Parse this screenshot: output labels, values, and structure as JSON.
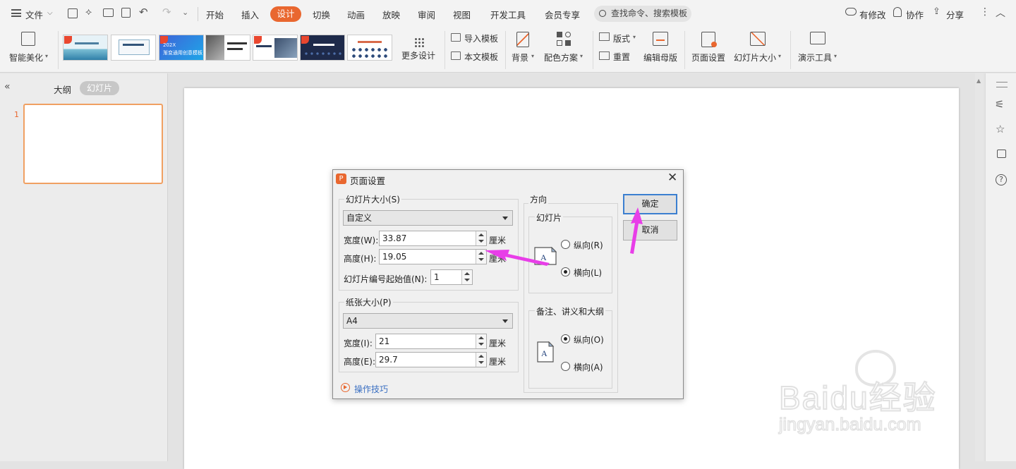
{
  "menubar": {
    "file": "文件",
    "tabs": [
      "开始",
      "插入",
      "设计",
      "切换",
      "动画",
      "放映",
      "审阅",
      "视图",
      "开发工具",
      "会员专享"
    ],
    "active_tab": "设计",
    "search_placeholder": "查找命令、搜索模板",
    "modified": "有修改",
    "collab": "协作",
    "share": "分享"
  },
  "ribbon": {
    "smart_beautify": "智能美化",
    "more_design": "更多设计",
    "import_template": "导入模板",
    "this_template": "本文模板",
    "background": "背景",
    "color_scheme": "配色方案",
    "layout": "版式",
    "reset": "重置",
    "edit_master": "编辑母版",
    "page_setup": "页面设置",
    "slide_size": "幻灯片大小",
    "present_tools": "演示工具",
    "thumb2_line1": "202X",
    "thumb2_line2": "渐变通用创意模板"
  },
  "left_panel": {
    "outline_tab": "大纲",
    "slides_tab": "幻灯片",
    "slide_number": "1"
  },
  "dialog": {
    "title": "页面设置",
    "slide_size_group": "幻灯片大小(S)",
    "slide_size_value": "自定义",
    "width_label": "宽度(W):",
    "width_value": "33.87",
    "height_label": "高度(H):",
    "height_value": "19.05",
    "unit": "厘米",
    "start_num_label": "幻灯片编号起始值(N):",
    "start_num_value": "1",
    "paper_group": "纸张大小(P)",
    "paper_value": "A4",
    "paper_width_label": "宽度(I):",
    "paper_width_value": "21",
    "paper_height_label": "高度(E):",
    "paper_height_value": "29.7",
    "tips": "操作技巧",
    "orientation": "方向",
    "slide_orient_group": "幻灯片",
    "portrait_r": "纵向(R)",
    "landscape_l": "横向(L)",
    "notes_group": "备注、讲义和大纲",
    "portrait_o": "纵向(O)",
    "landscape_a": "横向(A)",
    "ok": "确定",
    "cancel": "取消"
  },
  "watermark": {
    "line1": "Baidu经验",
    "line2": "jingyan.baidu.com"
  },
  "colors": {
    "accent": "#e9672f",
    "arrow": "#e83ee8",
    "selection": "#f0a062"
  }
}
